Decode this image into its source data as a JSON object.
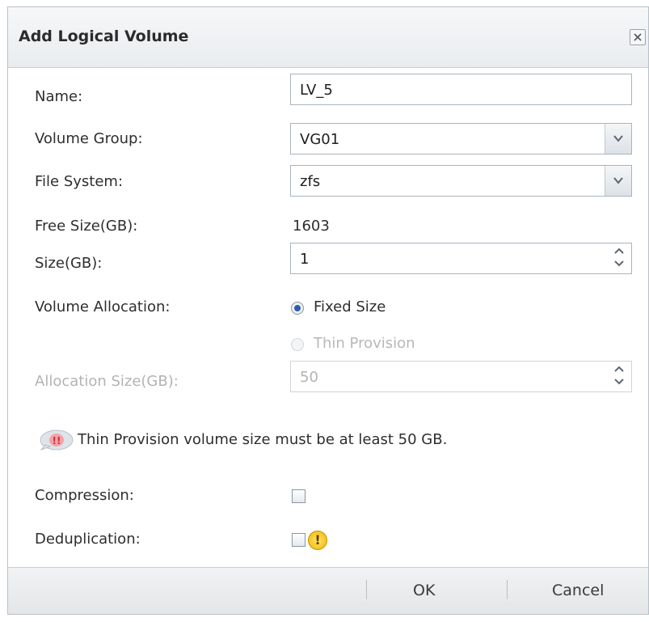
{
  "dialog": {
    "title": "Add Logical Volume",
    "close_icon": "close-icon"
  },
  "form": {
    "name": {
      "label": "Name:",
      "value": "LV_5"
    },
    "volume_group": {
      "label": "Volume Group:",
      "value": "VG01"
    },
    "file_system": {
      "label": "File System:",
      "value": "zfs"
    },
    "free_size": {
      "label": "Free Size(GB):",
      "value": "1603"
    },
    "size": {
      "label": "Size(GB):",
      "value": "1"
    },
    "volume_allocation": {
      "label": "Volume Allocation:",
      "options": [
        {
          "label": "Fixed Size",
          "checked": true,
          "enabled": true
        },
        {
          "label": "Thin Provision",
          "checked": false,
          "enabled": false
        }
      ]
    },
    "allocation_size": {
      "label": "Allocation Size(GB):",
      "value": "50",
      "enabled": false
    },
    "note": {
      "text": "Thin Provision volume size must be at least 50 GB.",
      "icon": "info-bubble-icon"
    },
    "compression": {
      "label": "Compression:",
      "checked": false
    },
    "deduplication": {
      "label": "Deduplication:",
      "checked": false,
      "warning_icon": "warning-icon"
    }
  },
  "footer": {
    "ok_label": "OK",
    "cancel_label": "Cancel"
  },
  "colors": {
    "radio_selected": "#2a5fa8",
    "warning": "#f2b600",
    "disabled_text": "#b3b3b3"
  }
}
